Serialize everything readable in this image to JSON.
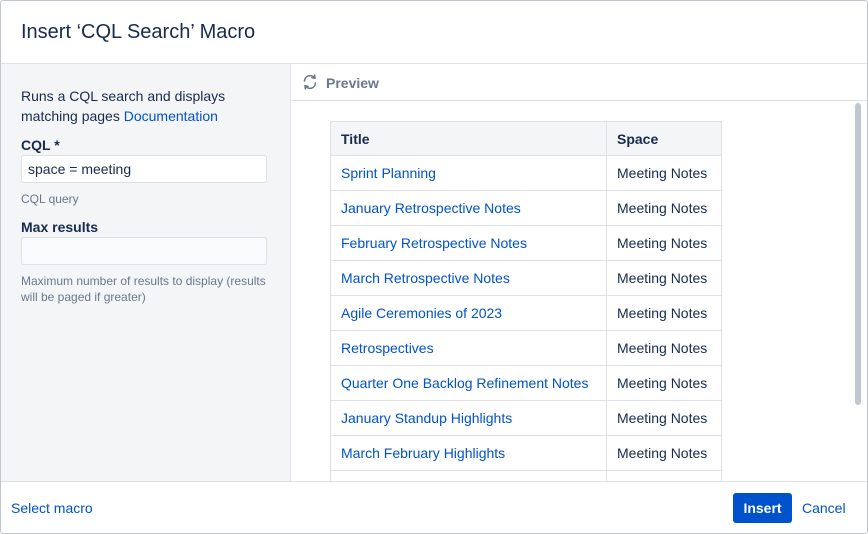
{
  "dialog": {
    "title": "Insert ‘CQL Search’ Macro"
  },
  "left": {
    "description": "Runs a CQL search and displays matching pages ",
    "doc_link": "Documentation",
    "cql_label": "CQL *",
    "cql_value": "space = meeting",
    "cql_hint": "CQL query",
    "max_label": "Max results",
    "max_value": "",
    "max_hint": "Maximum number of results to display (results will be paged if greater)"
  },
  "preview": {
    "title": "Preview",
    "icon": "refresh-icon",
    "columns": [
      "Title",
      "Space"
    ],
    "rows": [
      [
        "Sprint Planning",
        "Meeting Notes"
      ],
      [
        "January Retrospective Notes",
        "Meeting Notes"
      ],
      [
        "February Retrospective Notes",
        "Meeting Notes"
      ],
      [
        "March Retrospective Notes",
        "Meeting Notes"
      ],
      [
        "Agile Ceremonies of 2023",
        "Meeting Notes"
      ],
      [
        "Retrospectives",
        "Meeting Notes"
      ],
      [
        "Quarter One Backlog Refinement Notes",
        "Meeting Notes"
      ],
      [
        "January Standup Highlights",
        "Meeting Notes"
      ],
      [
        "March February Highlights",
        "Meeting Notes"
      ],
      [
        "",
        ""
      ]
    ]
  },
  "footer": {
    "select_macro": "Select macro",
    "insert": "Insert",
    "cancel": "Cancel"
  },
  "colors": {
    "accent": "#0052cc",
    "panel": "#f4f5f7",
    "border": "#dfe1e6"
  }
}
